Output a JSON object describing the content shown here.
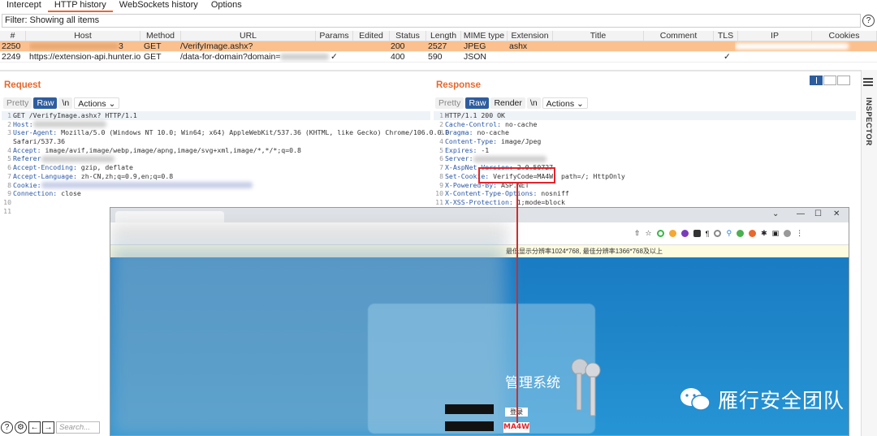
{
  "tabs": [
    "Intercept",
    "HTTP history",
    "WebSockets history",
    "Options"
  ],
  "filter": {
    "text": "Filter: Showing all items",
    "help": "?"
  },
  "table": {
    "headers": [
      "#",
      "Host",
      "Method",
      "URL",
      "Params",
      "Edited",
      "Status",
      "Length",
      "MIME type",
      "Extension",
      "Title",
      "Comment",
      "TLS",
      "IP",
      "Cookies"
    ],
    "rows": [
      {
        "num": "2250",
        "host": "3",
        "method": "GET",
        "url": "/VerifyImage.ashx?",
        "params": "",
        "status": "200",
        "length": "2527",
        "mime": "JPEG",
        "ext": "ashx",
        "tls": ""
      },
      {
        "num": "2249",
        "host": "https://extension-api.hunter.io",
        "method": "GET",
        "url": "/data-for-domain?domain=",
        "params": "✓",
        "status": "400",
        "length": "590",
        "mime": "JSON",
        "ext": "",
        "tls": "✓"
      }
    ]
  },
  "request": {
    "title": "Request",
    "toolbar": {
      "pretty": "Pretty",
      "raw": "Raw",
      "newline": "\\n",
      "actions": "Actions"
    },
    "lines": [
      {
        "n": "1",
        "key": "",
        "val": "GET /VerifyImage.ashx? HTTP/1.1"
      },
      {
        "n": "2",
        "key": "Host:",
        "val": ""
      },
      {
        "n": "3",
        "key": "User-Agent:",
        "val": " Mozilla/5.0 (Windows NT 10.0; Win64; x64) AppleWebKit/537.36 (KHTML, like Gecko) Chrome/106.0.0.0"
      },
      {
        "n": "",
        "key": "",
        "val": "Safari/537.36"
      },
      {
        "n": "4",
        "key": "Accept:",
        "val": " image/avif,image/webp,image/apng,image/svg+xml,image/*,*/*;q=0.8"
      },
      {
        "n": "5",
        "key": "Referer",
        "val": ""
      },
      {
        "n": "6",
        "key": "Accept-Encoding:",
        "val": " gzip, deflate"
      },
      {
        "n": "7",
        "key": "Accept-Language:",
        "val": " zh-CN,zh;q=0.9,en;q=0.8"
      },
      {
        "n": "8",
        "key": "Cookie:",
        "val": ""
      },
      {
        "n": "9",
        "key": "Connection:",
        "val": " close"
      },
      {
        "n": "10",
        "key": "",
        "val": ""
      },
      {
        "n": "11",
        "key": "",
        "val": ""
      }
    ]
  },
  "response": {
    "title": "Response",
    "toolbar": {
      "pretty": "Pretty",
      "raw": "Raw",
      "render": "Render",
      "newline": "\\n",
      "actions": "Actions"
    },
    "lines": [
      {
        "n": "1",
        "key": "",
        "val": "HTTP/1.1 200 OK"
      },
      {
        "n": "2",
        "key": "Cache-Control:",
        "val": " no-cache"
      },
      {
        "n": "3",
        "key": "Pragma:",
        "val": " no-cache"
      },
      {
        "n": "4",
        "key": "Content-Type:",
        "val": " image/Jpeg"
      },
      {
        "n": "5",
        "key": "Expires:",
        "val": " -1"
      },
      {
        "n": "6",
        "key": "Server:",
        "val": ""
      },
      {
        "n": "7",
        "key": "X-AspNet-Version:",
        "val": " 2.0.50727"
      },
      {
        "n": "8",
        "key": "Set-Cookie:",
        "val": " VerifyCode=MA4W; path=/; HttpOnly"
      },
      {
        "n": "9",
        "key": "X-Powered-By:",
        "val": " ASP.NET"
      },
      {
        "n": "10",
        "key": "X-Content-Type-Options:",
        "val": " nosniff"
      },
      {
        "n": "11",
        "key": "X-XSS-Protection:",
        "val": " 1;mode=block"
      }
    ]
  },
  "inspector": {
    "label": "INSPECTOR"
  },
  "bottom": {
    "search_placeholder": "Search..."
  },
  "browser": {
    "infobar": "最低显示分辨率1024*768, 最佳分辨率1366*768及以上",
    "system_title": "管理系统",
    "login_label": "登录",
    "captcha_text": "MA4W",
    "watermark": "雁行安全团队"
  }
}
